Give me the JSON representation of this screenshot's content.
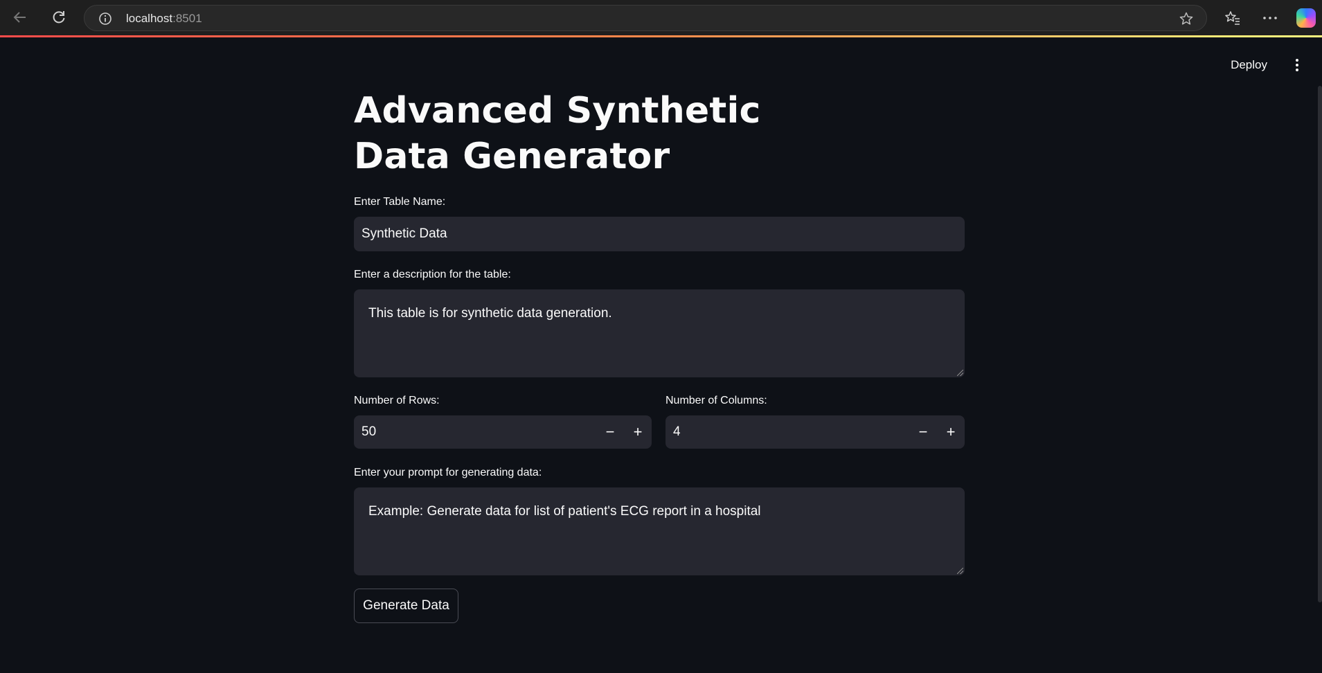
{
  "browser": {
    "url_host": "localhost",
    "url_port": ":8501"
  },
  "toolbar": {
    "deploy_label": "Deploy"
  },
  "page": {
    "title": "Advanced Synthetic Data Generator"
  },
  "form": {
    "table_name": {
      "label": "Enter Table Name:",
      "value": "Synthetic Data"
    },
    "description": {
      "label": "Enter a description for the table:",
      "value": "This table is for synthetic data generation."
    },
    "rows": {
      "label": "Number of Rows:",
      "value": "50",
      "minus": "−",
      "plus": "+"
    },
    "columns": {
      "label": "Number of Columns:",
      "value": "4",
      "minus": "−",
      "plus": "+"
    },
    "prompt": {
      "label": "Enter your prompt for generating data:",
      "value": "Example: Generate data for list of patient's ECG report in a hospital"
    },
    "generate_label": "Generate Data"
  },
  "colors": {
    "background": "#0e1117",
    "input_bg": "#262730",
    "accent_start": "#ff4b4b",
    "accent_end": "#fffd80"
  }
}
